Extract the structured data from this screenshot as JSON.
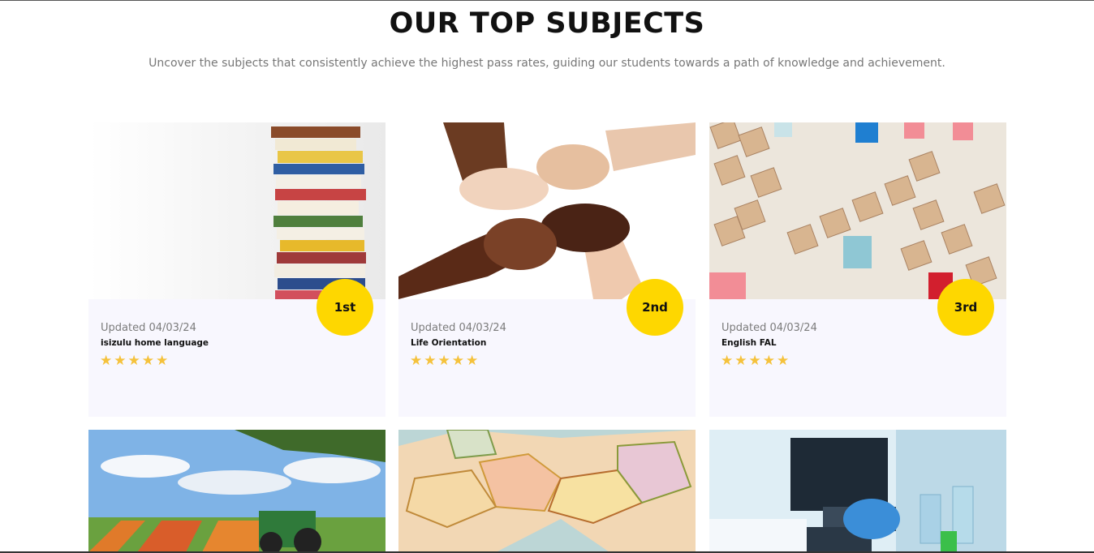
{
  "section": {
    "title": "OUR TOP SUBJECTS",
    "subtitle": "Uncover the subjects that consistently achieve the highest pass rates, guiding our students towards a path of knowledge and achievement."
  },
  "colors": {
    "badge": "#fed700",
    "star": "#f5c23c",
    "card_bg": "#f8f7fe"
  },
  "cards": [
    {
      "rank": "1st",
      "updated": "Updated 04/03/24",
      "subject": "isizulu home language",
      "rating": 5,
      "stars": "★★★★★",
      "image": "books-stack-image"
    },
    {
      "rank": "2nd",
      "updated": "Updated 04/03/24",
      "subject": "Life Orientation",
      "rating": 5,
      "stars": "★★★★★",
      "image": "linked-hands-image"
    },
    {
      "rank": "3rd",
      "updated": "Updated 04/03/24",
      "subject": "English FAL",
      "rating": 5,
      "stars": "★★★★★",
      "image": "scrabble-tiles-image"
    }
  ],
  "more_cards": [
    {
      "image": "farm-field-tractor-image"
    },
    {
      "image": "europe-map-image"
    },
    {
      "image": "laboratory-microscope-image"
    }
  ]
}
